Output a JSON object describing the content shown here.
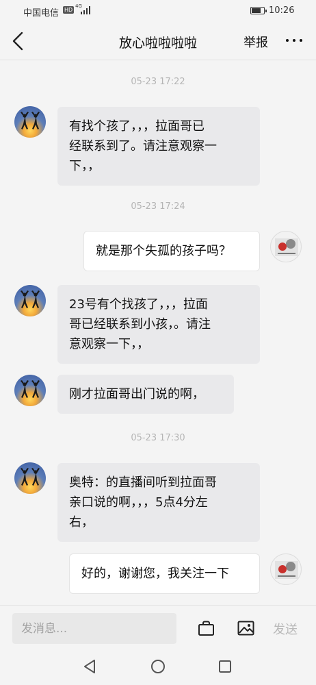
{
  "status_bar": {
    "carrier": "中国电信",
    "network_badge": "HD",
    "network_type": "4G",
    "time": "10:26",
    "battery_level": 0.8
  },
  "header": {
    "title": "放心啦啦啦啦",
    "report_label": "举报",
    "back_icon": "chevron-left-icon",
    "more_icon": "more-dots-icon"
  },
  "messages": [
    {
      "type": "time",
      "text": "05-23 17:22"
    },
    {
      "type": "incoming",
      "text": "有找个孩了，，，拉面哥已\n经联系到了。请注意观察一\n下，，"
    },
    {
      "type": "time",
      "text": "05-23 17:24"
    },
    {
      "type": "outgoing",
      "text": "就是那个失孤的孩子吗？"
    },
    {
      "type": "incoming",
      "text": "23号有个找孩了，，，拉面\n哥已经联系到小孩，。请注\n意观察一下，，"
    },
    {
      "type": "incoming",
      "text": "刚才拉面哥出门说的啊，"
    },
    {
      "type": "time",
      "text": "05-23 17:30"
    },
    {
      "type": "incoming",
      "text": "奥特：的直播间听到拉面哥\n亲口说的啊，，，5点4分左\n右，"
    },
    {
      "type": "outgoing",
      "text": "好的，谢谢您，我关注一下"
    }
  ],
  "input_bar": {
    "placeholder": "发消息...",
    "send_label": "发送",
    "bag_icon": "shopping-bag-icon",
    "image_icon": "image-icon"
  },
  "nav_bar": {
    "back_icon": "triangle-back-icon",
    "home_icon": "circle-home-icon",
    "recent_icon": "square-recent-icon"
  }
}
